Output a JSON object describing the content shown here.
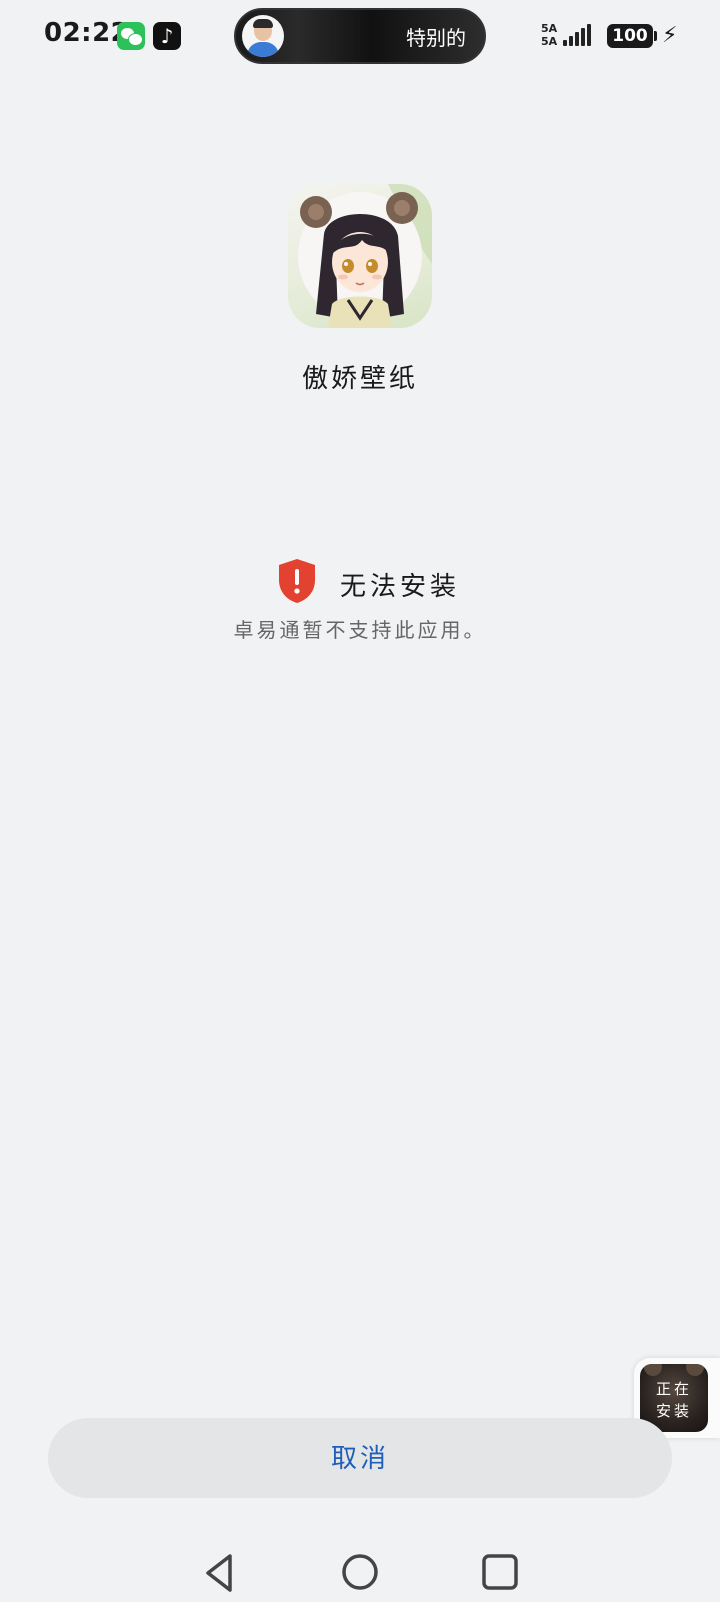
{
  "status_bar": {
    "time": "02:22",
    "notification_icons": [
      "wechat-icon",
      "tiktok-icon"
    ],
    "island_text": "特别的",
    "network_label_1": "5A",
    "network_label_2": "5A",
    "battery": "100",
    "charging": true
  },
  "app": {
    "name": "傲娇壁纸",
    "icon": "anime-girl-app-icon"
  },
  "error": {
    "icon": "shield-warning-icon",
    "color": "#e2422f",
    "title": "无法安装",
    "description": "卓易通暂不支持此应用。"
  },
  "floating_task": {
    "label_line1": "正在",
    "label_line2": "安装"
  },
  "actions": {
    "cancel_label": "取消",
    "cancel_color": "#1f5fb8"
  },
  "nav": {
    "icons": [
      "back-icon",
      "home-icon",
      "recents-icon"
    ]
  }
}
